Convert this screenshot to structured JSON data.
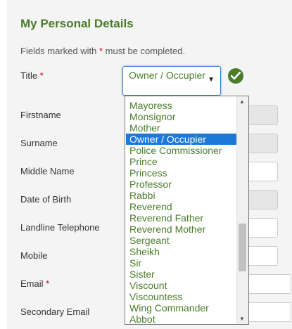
{
  "form": {
    "heading": "My Personal Details",
    "intro_text": "Fields marked with ",
    "intro_star": "*",
    "intro_suffix": " must be completed.",
    "required_marker": "*"
  },
  "fields": {
    "title": "Title",
    "firstname": "Firstname",
    "surname": "Surname",
    "middle_name": "Middle Name",
    "dob": "Date of Birth",
    "landline": "Landline Telephone",
    "mobile": "Mobile",
    "email": "Email",
    "secondary_email": "Secondary Email"
  },
  "title_select": {
    "value": "Owner / Occupier",
    "status_icon": "check-circle-icon",
    "accent_color": "#4a7c2a",
    "focus_color": "#3b7ec8"
  },
  "dropdown": {
    "options": [
      "Mayoress",
      "Monsignor",
      "Mother",
      "Owner / Occupier",
      "Police Commissioner",
      "Prince",
      "Princess",
      "Professor",
      "Rabbi",
      "Reverend",
      "Reverend Father",
      "Reverend Mother",
      "Sergeant",
      "Sheikh",
      "Sir",
      "Sister",
      "Viscount",
      "Viscountess",
      "Wing Commander",
      "Abbot"
    ],
    "selected": "Owner / Occupier",
    "selected_color": "#1e78d7"
  }
}
